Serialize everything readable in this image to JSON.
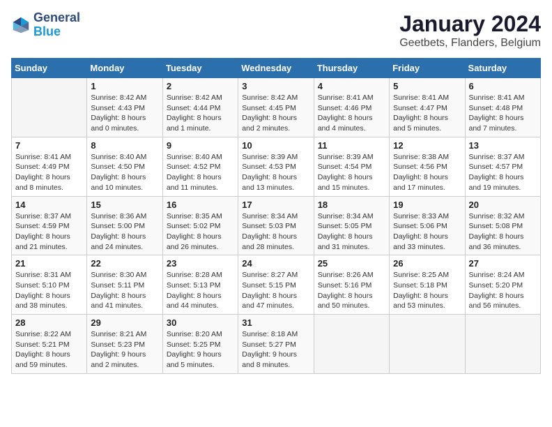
{
  "header": {
    "logo_line1": "General",
    "logo_line2": "Blue",
    "title": "January 2024",
    "subtitle": "Geetbets, Flanders, Belgium"
  },
  "weekdays": [
    "Sunday",
    "Monday",
    "Tuesday",
    "Wednesday",
    "Thursday",
    "Friday",
    "Saturday"
  ],
  "weeks": [
    [
      {
        "day": "",
        "info": ""
      },
      {
        "day": "1",
        "info": "Sunrise: 8:42 AM\nSunset: 4:43 PM\nDaylight: 8 hours\nand 0 minutes."
      },
      {
        "day": "2",
        "info": "Sunrise: 8:42 AM\nSunset: 4:44 PM\nDaylight: 8 hours\nand 1 minute."
      },
      {
        "day": "3",
        "info": "Sunrise: 8:42 AM\nSunset: 4:45 PM\nDaylight: 8 hours\nand 2 minutes."
      },
      {
        "day": "4",
        "info": "Sunrise: 8:41 AM\nSunset: 4:46 PM\nDaylight: 8 hours\nand 4 minutes."
      },
      {
        "day": "5",
        "info": "Sunrise: 8:41 AM\nSunset: 4:47 PM\nDaylight: 8 hours\nand 5 minutes."
      },
      {
        "day": "6",
        "info": "Sunrise: 8:41 AM\nSunset: 4:48 PM\nDaylight: 8 hours\nand 7 minutes."
      }
    ],
    [
      {
        "day": "7",
        "info": "Sunrise: 8:41 AM\nSunset: 4:49 PM\nDaylight: 8 hours\nand 8 minutes."
      },
      {
        "day": "8",
        "info": "Sunrise: 8:40 AM\nSunset: 4:50 PM\nDaylight: 8 hours\nand 10 minutes."
      },
      {
        "day": "9",
        "info": "Sunrise: 8:40 AM\nSunset: 4:52 PM\nDaylight: 8 hours\nand 11 minutes."
      },
      {
        "day": "10",
        "info": "Sunrise: 8:39 AM\nSunset: 4:53 PM\nDaylight: 8 hours\nand 13 minutes."
      },
      {
        "day": "11",
        "info": "Sunrise: 8:39 AM\nSunset: 4:54 PM\nDaylight: 8 hours\nand 15 minutes."
      },
      {
        "day": "12",
        "info": "Sunrise: 8:38 AM\nSunset: 4:56 PM\nDaylight: 8 hours\nand 17 minutes."
      },
      {
        "day": "13",
        "info": "Sunrise: 8:37 AM\nSunset: 4:57 PM\nDaylight: 8 hours\nand 19 minutes."
      }
    ],
    [
      {
        "day": "14",
        "info": "Sunrise: 8:37 AM\nSunset: 4:59 PM\nDaylight: 8 hours\nand 21 minutes."
      },
      {
        "day": "15",
        "info": "Sunrise: 8:36 AM\nSunset: 5:00 PM\nDaylight: 8 hours\nand 24 minutes."
      },
      {
        "day": "16",
        "info": "Sunrise: 8:35 AM\nSunset: 5:02 PM\nDaylight: 8 hours\nand 26 minutes."
      },
      {
        "day": "17",
        "info": "Sunrise: 8:34 AM\nSunset: 5:03 PM\nDaylight: 8 hours\nand 28 minutes."
      },
      {
        "day": "18",
        "info": "Sunrise: 8:34 AM\nSunset: 5:05 PM\nDaylight: 8 hours\nand 31 minutes."
      },
      {
        "day": "19",
        "info": "Sunrise: 8:33 AM\nSunset: 5:06 PM\nDaylight: 8 hours\nand 33 minutes."
      },
      {
        "day": "20",
        "info": "Sunrise: 8:32 AM\nSunset: 5:08 PM\nDaylight: 8 hours\nand 36 minutes."
      }
    ],
    [
      {
        "day": "21",
        "info": "Sunrise: 8:31 AM\nSunset: 5:10 PM\nDaylight: 8 hours\nand 38 minutes."
      },
      {
        "day": "22",
        "info": "Sunrise: 8:30 AM\nSunset: 5:11 PM\nDaylight: 8 hours\nand 41 minutes."
      },
      {
        "day": "23",
        "info": "Sunrise: 8:28 AM\nSunset: 5:13 PM\nDaylight: 8 hours\nand 44 minutes."
      },
      {
        "day": "24",
        "info": "Sunrise: 8:27 AM\nSunset: 5:15 PM\nDaylight: 8 hours\nand 47 minutes."
      },
      {
        "day": "25",
        "info": "Sunrise: 8:26 AM\nSunset: 5:16 PM\nDaylight: 8 hours\nand 50 minutes."
      },
      {
        "day": "26",
        "info": "Sunrise: 8:25 AM\nSunset: 5:18 PM\nDaylight: 8 hours\nand 53 minutes."
      },
      {
        "day": "27",
        "info": "Sunrise: 8:24 AM\nSunset: 5:20 PM\nDaylight: 8 hours\nand 56 minutes."
      }
    ],
    [
      {
        "day": "28",
        "info": "Sunrise: 8:22 AM\nSunset: 5:21 PM\nDaylight: 8 hours\nand 59 minutes."
      },
      {
        "day": "29",
        "info": "Sunrise: 8:21 AM\nSunset: 5:23 PM\nDaylight: 9 hours\nand 2 minutes."
      },
      {
        "day": "30",
        "info": "Sunrise: 8:20 AM\nSunset: 5:25 PM\nDaylight: 9 hours\nand 5 minutes."
      },
      {
        "day": "31",
        "info": "Sunrise: 8:18 AM\nSunset: 5:27 PM\nDaylight: 9 hours\nand 8 minutes."
      },
      {
        "day": "",
        "info": ""
      },
      {
        "day": "",
        "info": ""
      },
      {
        "day": "",
        "info": ""
      }
    ]
  ]
}
